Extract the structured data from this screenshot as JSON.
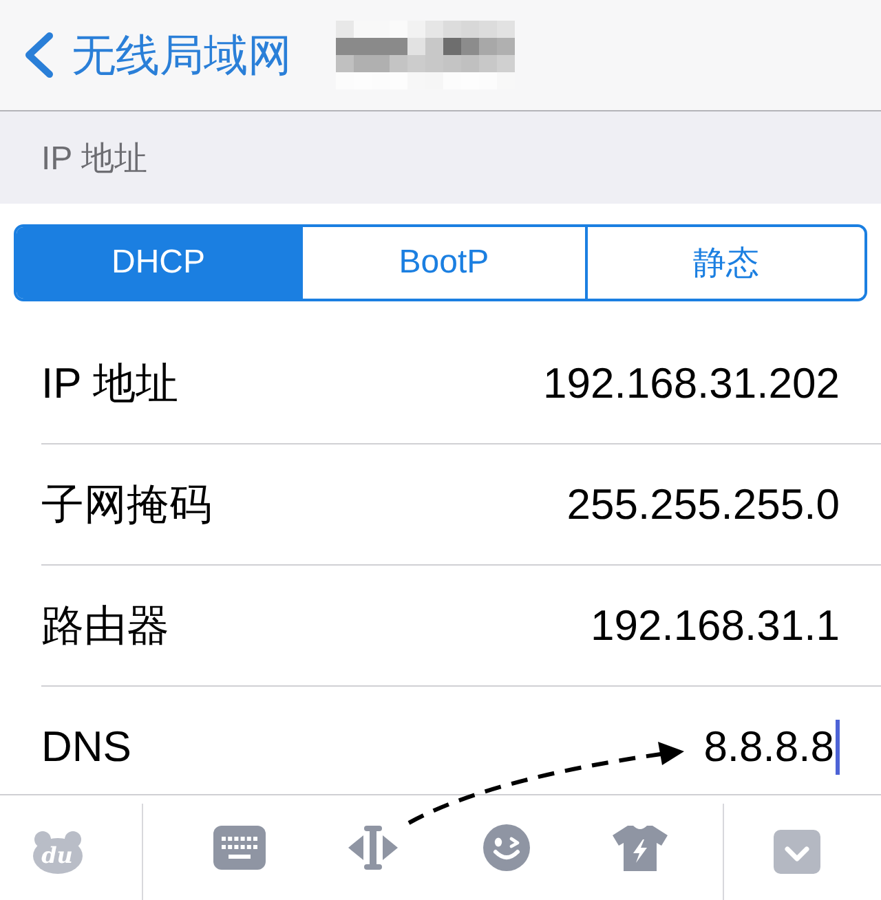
{
  "nav_bar": {
    "back_label": "无线局域网"
  },
  "section_header": "IP 地址",
  "segmented_control": [
    {
      "label": "DHCP",
      "selected": true
    },
    {
      "label": "BootP",
      "selected": false
    },
    {
      "label": "静态",
      "selected": false
    }
  ],
  "fields": [
    {
      "label": "IP 地址",
      "value": "192.168.31.202",
      "focused": false
    },
    {
      "label": "子网掩码",
      "value": "255.255.255.0",
      "focused": false
    },
    {
      "label": "路由器",
      "value": "192.168.31.1",
      "focused": false
    },
    {
      "label": "DNS",
      "value": "8.8.8.8",
      "focused": true
    }
  ],
  "keyboard_toolbar": {
    "logo_text": "du"
  }
}
